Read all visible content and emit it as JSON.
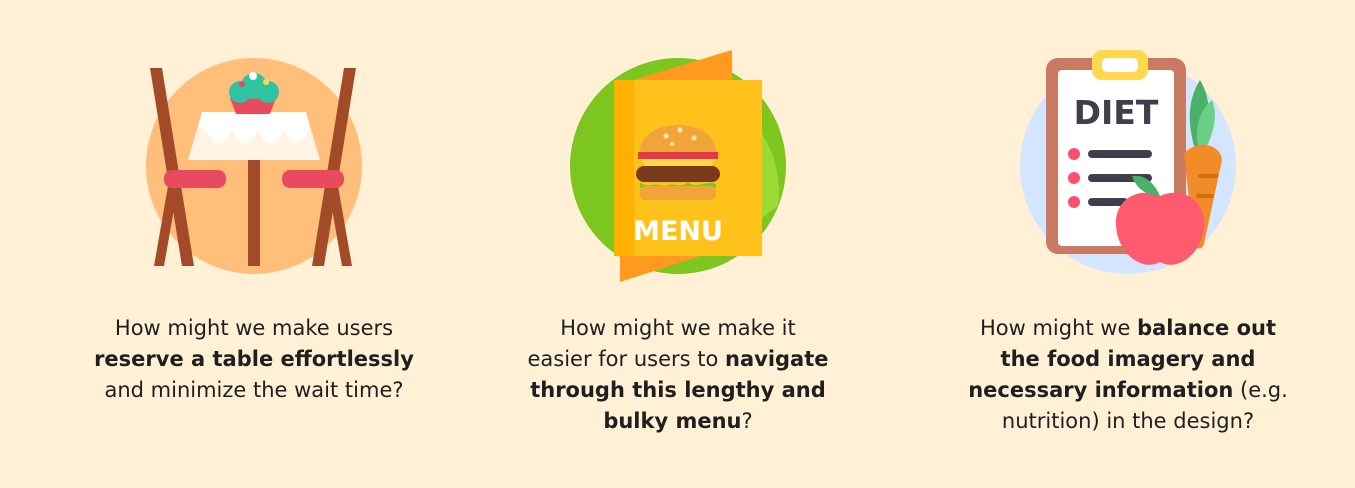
{
  "background_color": "#fff0d6",
  "cards": [
    {
      "icon": "dining-table-icon",
      "lines": [
        [
          {
            "t": "How might we make users",
            "b": false
          }
        ],
        [
          {
            "t": "reserve a table effortlessly",
            "b": true
          }
        ],
        [
          {
            "t": "and minimize the wait time?",
            "b": false
          }
        ]
      ]
    },
    {
      "icon": "burger-menu-icon",
      "icon_label": "MENU",
      "lines": [
        [
          {
            "t": "How might we make it",
            "b": false
          }
        ],
        [
          {
            "t": "easier for users to ",
            "b": false
          },
          {
            "t": "navigate",
            "b": true
          }
        ],
        [
          {
            "t": "through this lengthy and",
            "b": true
          }
        ],
        [
          {
            "t": "bulky menu",
            "b": true
          },
          {
            "t": "?",
            "b": false
          }
        ]
      ]
    },
    {
      "icon": "diet-clipboard-icon",
      "icon_label": "DIET",
      "lines": [
        [
          {
            "t": "How might we ",
            "b": false
          },
          {
            "t": "balance out",
            "b": true
          }
        ],
        [
          {
            "t": "the food imagery and",
            "b": true
          }
        ],
        [
          {
            "t": "necessary information",
            "b": true
          },
          {
            "t": " (e.g.",
            "b": false
          }
        ],
        [
          {
            "t": "nutrition) in the design?",
            "b": false
          }
        ]
      ]
    }
  ]
}
